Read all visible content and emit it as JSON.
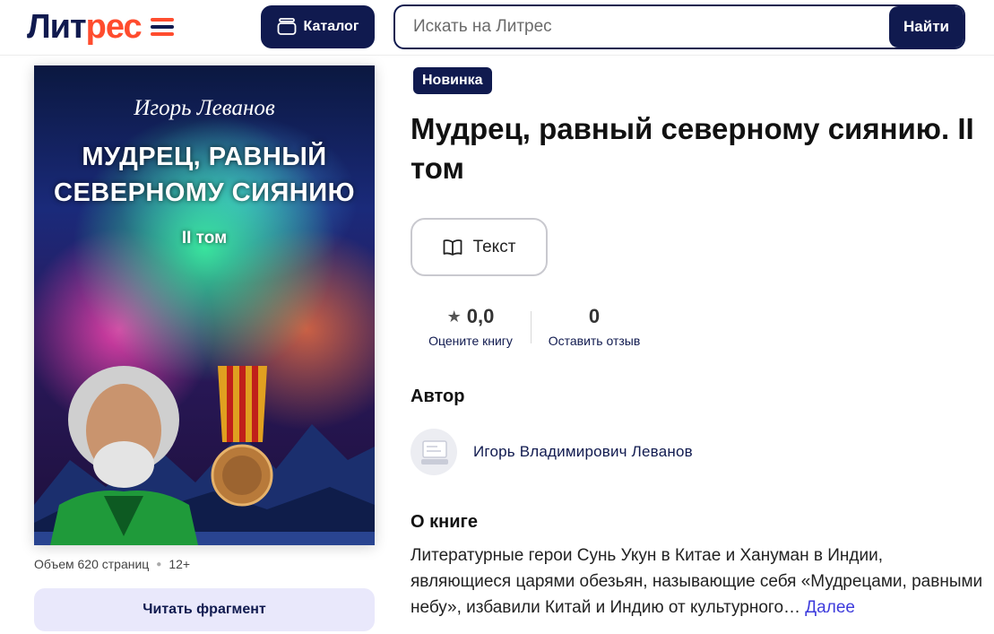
{
  "header": {
    "logo_part1": "Лит",
    "logo_part2": "рес",
    "catalog_label": "Каталог",
    "search_placeholder": "Искать на Литрес",
    "search_button": "Найти"
  },
  "book": {
    "badge": "Новинка",
    "title": "Мудрец, равный северному сиянию. II том",
    "format_label": "Текст",
    "rating_value": "0,0",
    "rating_link": "Оцените книгу",
    "reviews_count": "0",
    "reviews_link": "Оставить отзыв",
    "pages_info": "Объем 620 страниц",
    "age_rating": "12+",
    "read_button": "Читать фрагмент"
  },
  "cover": {
    "author": "Игорь Леванов",
    "title_line1": "МУДРЕЦ, РАВНЫЙ",
    "title_line2": "СЕВЕРНОМУ СИЯНИЮ",
    "volume": "II том"
  },
  "author_section": {
    "heading": "Автор",
    "name": "Игорь Владимирович Леванов"
  },
  "about_section": {
    "heading": "О книге",
    "text": "Литературные герои Сунь Укун в Китае и Хануман в Индии, являющиеся царями обезьян, называющие себя «Мудрецами, равными небу», избавили Китай и Индию от культурного…",
    "more_link": "Далее"
  },
  "colors": {
    "brand_navy": "#101a4f",
    "brand_red": "#ff4c2e",
    "link": "#3d3bdc",
    "read_button_bg": "#e9e8fb"
  },
  "icons": [
    "catalog-icon",
    "book-open-icon",
    "star-icon",
    "author-avatar-icon"
  ]
}
